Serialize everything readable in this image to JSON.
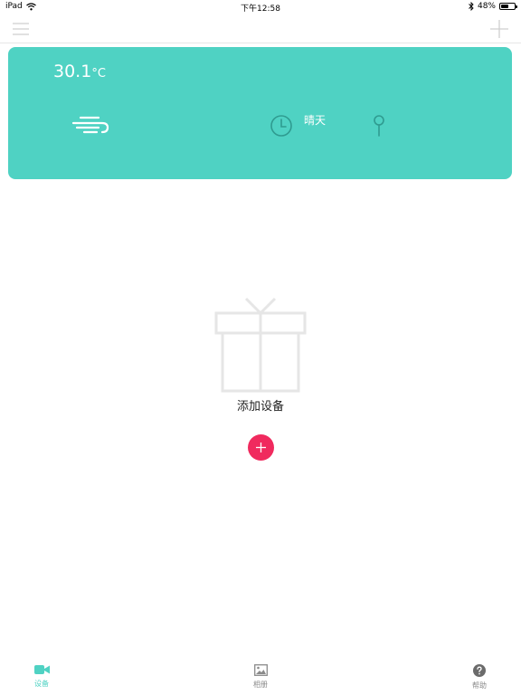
{
  "status_bar": {
    "device": "iPad",
    "time": "下午12:58",
    "battery_percent": "48%",
    "battery_level": 0.48,
    "icons": [
      "wifi-icon",
      "bluetooth-icon",
      "battery-icon"
    ]
  },
  "nav_bar": {
    "left_icon": "menu-icon",
    "right_icon": "plus-icon"
  },
  "weather": {
    "temperature": "30.1",
    "unit": "°C",
    "condition": "晴天",
    "icons": [
      "wind-icon",
      "clock-icon",
      "location-pin-icon"
    ]
  },
  "empty_state": {
    "icon": "gift-icon",
    "label": "添加设备",
    "button_icon": "plus-icon"
  },
  "tabs": [
    {
      "label": "设备",
      "icon": "video-camera-icon",
      "active": true
    },
    {
      "label": "相册",
      "icon": "image-icon",
      "active": false
    },
    {
      "label": "帮助",
      "icon": "help-icon",
      "active": false
    }
  ],
  "colors": {
    "accent": "#4fd2c3",
    "add_button": "#f02a5e",
    "inactive_tab": "#8a8a8a"
  }
}
